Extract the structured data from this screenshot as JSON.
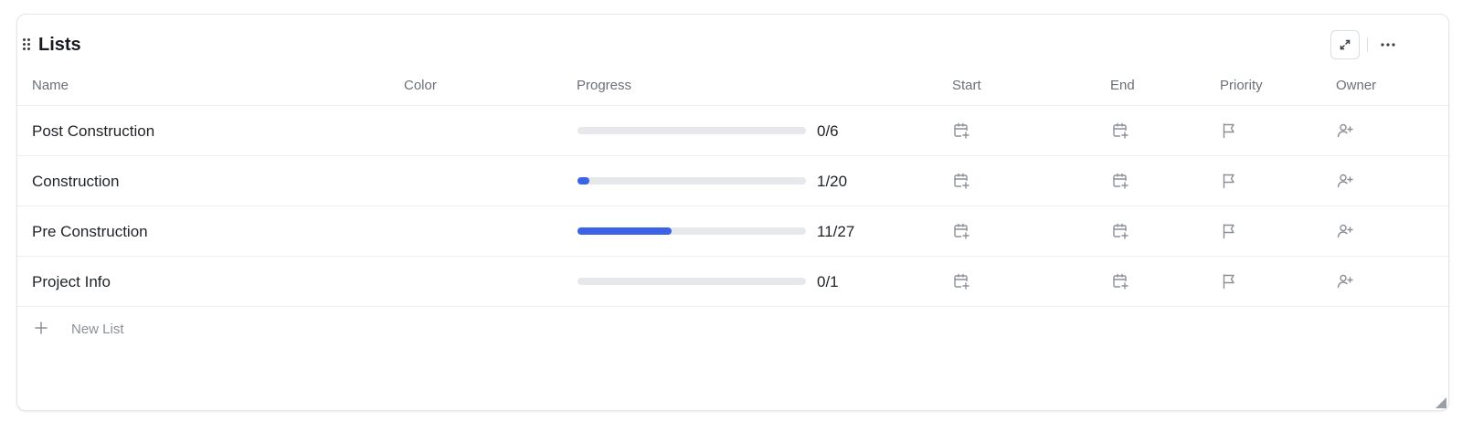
{
  "widget": {
    "title": "Lists",
    "new_list_label": "New List"
  },
  "columns": {
    "name": "Name",
    "color": "Color",
    "progress": "Progress",
    "start": "Start",
    "end": "End",
    "priority": "Priority",
    "owner": "Owner"
  },
  "rows": [
    {
      "name": "Post Construction",
      "progress_label": "0/6",
      "progress_fraction": 0.0
    },
    {
      "name": "Construction",
      "progress_label": "1/20",
      "progress_fraction": 0.05
    },
    {
      "name": "Pre Construction",
      "progress_label": "11/27",
      "progress_fraction": 0.41
    },
    {
      "name": "Project Info",
      "progress_label": "0/1",
      "progress_fraction": 0.0
    }
  ],
  "icons": {
    "drag": "drag-handle-icon",
    "expand": "expand-icon",
    "more": "more-horizontal-icon",
    "start": "calendar-plus-icon",
    "end": "calendar-plus-icon",
    "priority": "flag-icon",
    "owner": "user-plus-icon",
    "add": "plus-icon",
    "resize": "resize-handle-icon"
  },
  "colors": {
    "progress_fill": "#3a63e6",
    "progress_track": "#e6e8eb",
    "icon": "#8b9098"
  }
}
